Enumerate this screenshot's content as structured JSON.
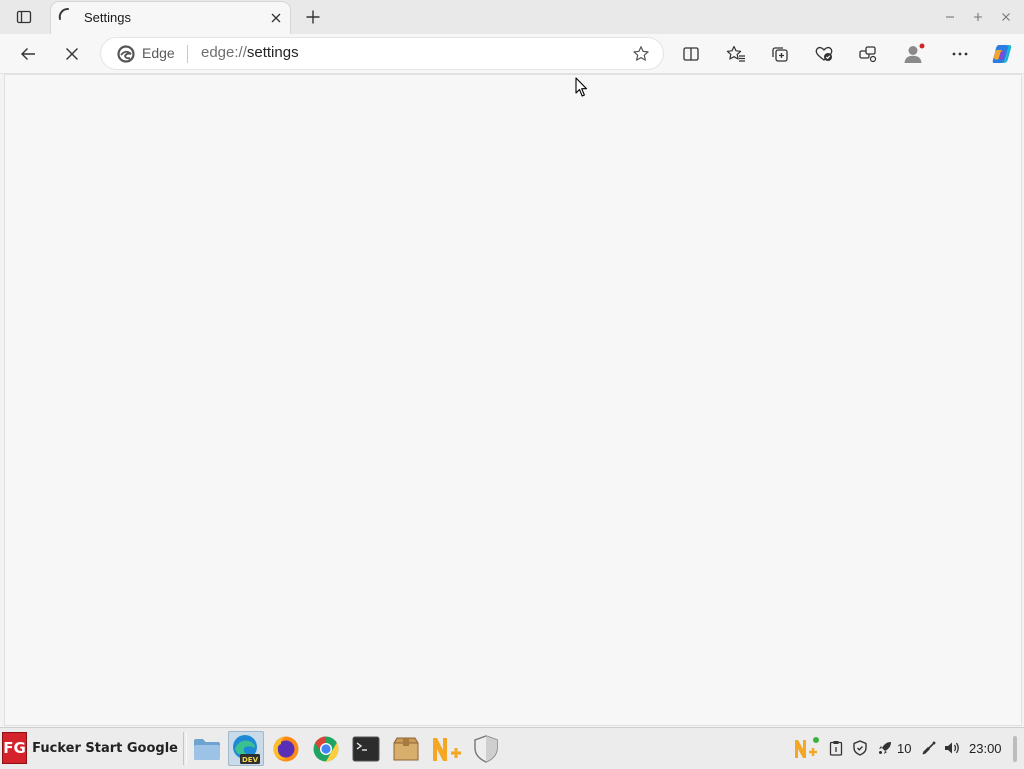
{
  "tab": {
    "title": "Settings",
    "loading": true
  },
  "address_bar": {
    "site_label": "Edge",
    "url_scheme": "edge://",
    "url_host": "settings"
  },
  "toolbar_icons": [
    "back-icon",
    "stop-icon",
    "favorite-star-icon",
    "split-screen-icon",
    "favorites-icon",
    "collections-icon",
    "browser-essentials-icon",
    "workspaces-icon",
    "profile-icon",
    "more-icon",
    "copilot-icon"
  ],
  "taskbar": {
    "start_label": "Fucker Start Google",
    "start_logo": "FG",
    "launchers": [
      "file-manager",
      "edge-dev",
      "firefox",
      "chrome",
      "terminal",
      "archive-manager",
      "notes-plus",
      "security-shield"
    ],
    "tray_badge": "10",
    "clock": "23:00"
  },
  "colors": {
    "accent": "#0078d4",
    "start_logo_bg": "#d4232a",
    "notification_dot": "#d1232a"
  }
}
